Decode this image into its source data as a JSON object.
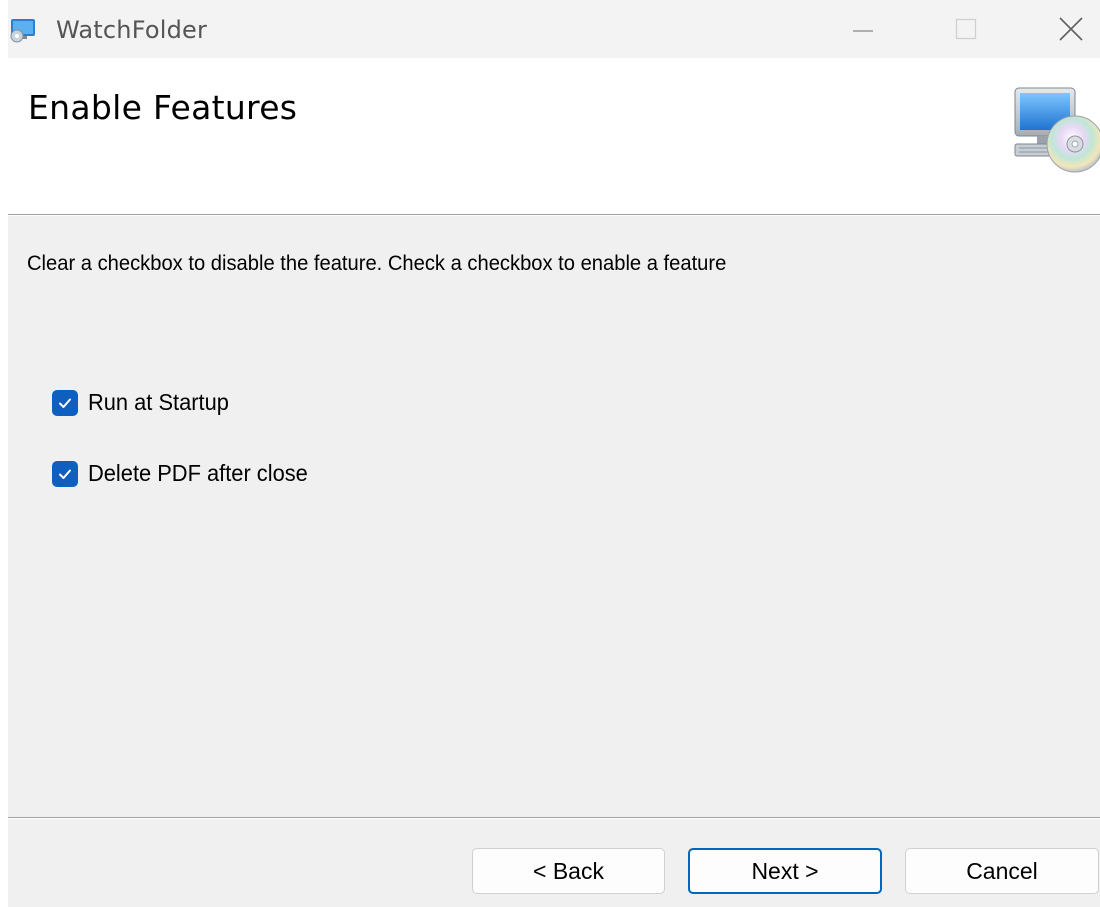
{
  "window": {
    "title": "WatchFolder",
    "icon": "installer-app-icon"
  },
  "titlebar": {
    "minimize_icon": "minimize-icon",
    "maximize_icon": "maximize-icon",
    "close_icon": "close-icon"
  },
  "banner": {
    "title": "Enable Features",
    "icon": "computer-cd-icon"
  },
  "body": {
    "description": "Clear a checkbox to disable the feature. Check a checkbox to enable a feature",
    "features": [
      {
        "label": "Run at Startup",
        "checked": true
      },
      {
        "label": "Delete PDF after close",
        "checked": true
      }
    ]
  },
  "footer": {
    "back_label": "< Back",
    "next_label": "Next >",
    "cancel_label": "Cancel"
  },
  "colors": {
    "accent": "#0067c0",
    "checkbox_fill": "#0f5fc0",
    "dialog_bg": "#f0f0f0"
  }
}
